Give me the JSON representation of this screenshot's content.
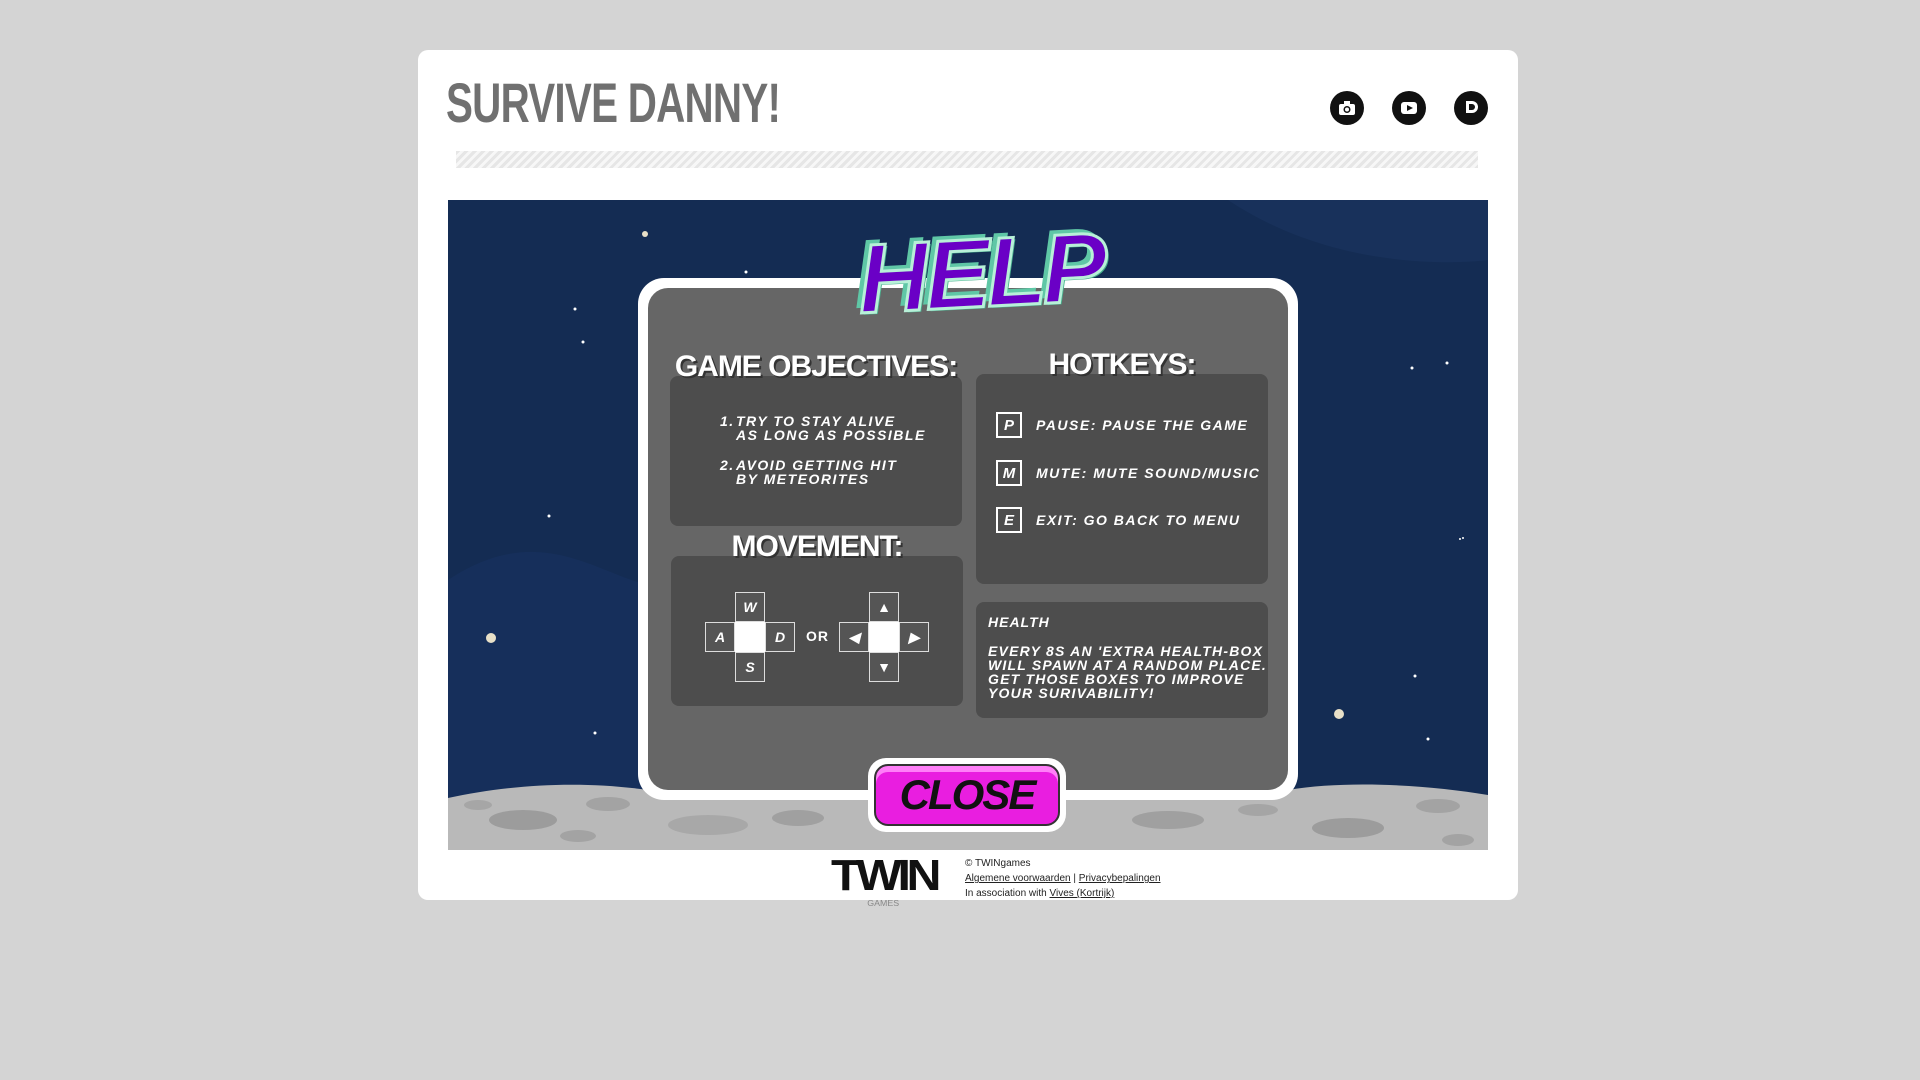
{
  "site": {
    "title": "SURVIVE DANNY!",
    "social": [
      {
        "name": "camera-icon"
      },
      {
        "name": "youtube-icon"
      },
      {
        "name": "discord-icon"
      }
    ]
  },
  "help": {
    "title": "HELP",
    "objectives": {
      "title": "GAME OBJECTIVES:",
      "items": [
        {
          "num": "1.",
          "line1": "TRY TO STAY ALIVE",
          "line2": "AS LONG AS POSSIBLE"
        },
        {
          "num": "2.",
          "line1": "AVOID GETTING HIT",
          "line2": "BY METEORITES"
        }
      ]
    },
    "hotkeys": {
      "title": "HOTKEYS:",
      "items": [
        {
          "key": "P",
          "desc": "PAUSE: PAUSE THE GAME"
        },
        {
          "key": "M",
          "desc": "MUTE: MUTE SOUND/MUSIC"
        },
        {
          "key": "E",
          "desc": "EXIT: GO BACK TO MENU"
        }
      ]
    },
    "movement": {
      "title": "MOVEMENT:",
      "keys": {
        "up": "W",
        "left": "A",
        "right": "D",
        "down": "S"
      },
      "or_label": "OR",
      "arrows": {
        "up": "▲",
        "left": "◀",
        "right": "▶",
        "down": "▼"
      }
    },
    "health": {
      "title": "HEALTH",
      "line1": "EVERY 8s AN 'EXTRA HEALTH-BOX",
      "line2": "WILL SPAWN AT A RANDOM PLACE.",
      "line3": "GET THOSE BOXES TO IMPROVE",
      "line4": "YOUR SURIVABILITY!"
    },
    "close_label": "CLOSE"
  },
  "footer": {
    "logo": "TWIN",
    "logo_sub": "GAMES",
    "copyright": "© TWINgames",
    "terms": "Algemene voorwaarden",
    "separator": "|",
    "privacy": "Privacybepalingen",
    "association_prefix": "In association with",
    "association_link": "Vives (Kortrijk)"
  }
}
